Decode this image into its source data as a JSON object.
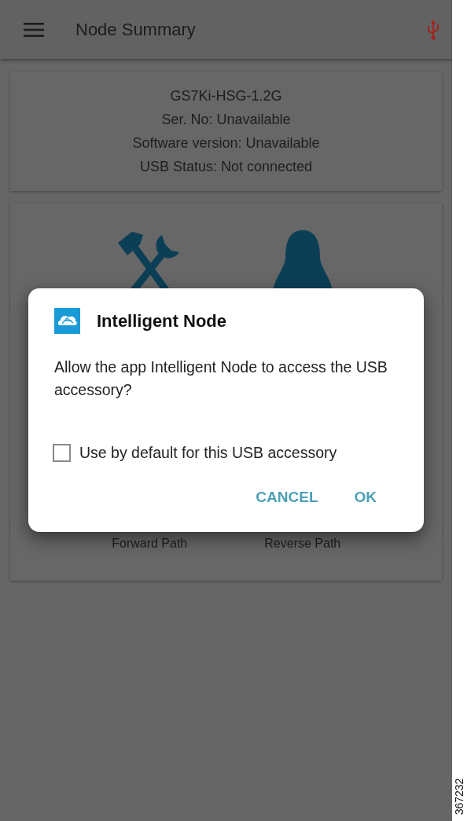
{
  "app_bar": {
    "title": "Node Summary"
  },
  "node_info": {
    "lines": [
      "GS7Ki-HSG-1.2G",
      "Ser. No: Unavailable",
      "Software version: Unavailable",
      "USB Status: Not connected"
    ]
  },
  "tiles": [
    {
      "kind": "tools",
      "label": "Forward Path"
    },
    {
      "kind": "person",
      "label": "Reverse Path"
    }
  ],
  "dialog": {
    "title": "Intelligent Node",
    "message": "Allow the app Intelligent Node to access the USB accessory?",
    "checkbox": {
      "label": "Use by default for this USB accessory",
      "checked": false
    },
    "buttons": [
      "CANCEL",
      "OK"
    ]
  },
  "figure_number": "367232"
}
